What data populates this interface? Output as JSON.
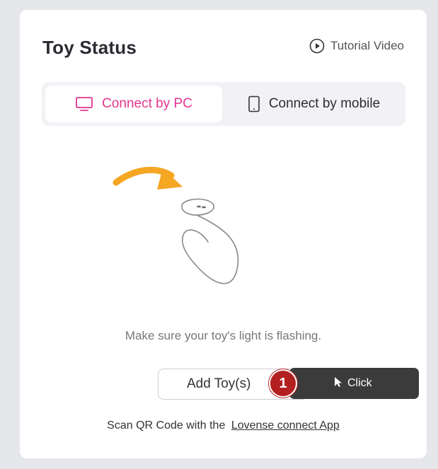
{
  "panel": {
    "title": "Toy Status",
    "tutorial_label": "Tutorial Video"
  },
  "tabs": [
    {
      "label": "Connect by PC",
      "active": true,
      "icon": "monitor-icon"
    },
    {
      "label": "Connect by mobile",
      "active": false,
      "icon": "phone-icon"
    }
  ],
  "hint": "Make sure your toy's light is flashing.",
  "add_button": {
    "label": "Add Toy(s)"
  },
  "callout": {
    "step": "1",
    "label": "Click",
    "icon": "cursor-icon"
  },
  "qr": {
    "prefix": "Scan QR Code with the",
    "link": "Lovense connect App"
  },
  "colors": {
    "accent": "#e2358f",
    "badge": "#b32020",
    "arrow": "#f5a623"
  }
}
